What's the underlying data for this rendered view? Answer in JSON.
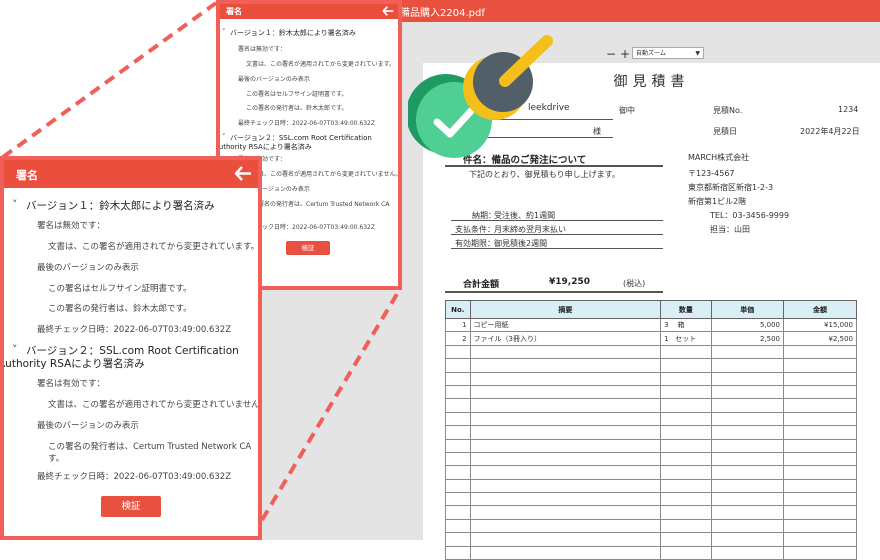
{
  "viewer": {
    "file_name": "備品購入2204.pdf",
    "zoom_minus": "−",
    "zoom_plus": "+",
    "zoom_value": "自動ズーム"
  },
  "document": {
    "title": "御見積書",
    "to_company": "leekdrive",
    "honorific_company": "御中",
    "honorific_person": "様",
    "estimate_no_label": "見積No.",
    "estimate_no": "1234",
    "estimate_date_label": "見積日",
    "estimate_date": "2022年4月22日",
    "subject": "件名：備品のご発注について",
    "intro": "下記のとおり、御見積もり申し上げます。",
    "issuer": {
      "company": "MARCH株式会社",
      "postal": "〒123-4567",
      "address1": "東京都新宿区新宿1-2-3",
      "address2": "新宿第1ビル2階",
      "tel": "TEL：03-3456-9999",
      "person": "担当：山田"
    },
    "terms": [
      {
        "label": "納期：",
        "value": "受注後、約1週間"
      },
      {
        "label": "支払条件：",
        "value": "月末締め翌月末払い"
      },
      {
        "label": "有効期限：",
        "value": "御見積後2週間"
      }
    ],
    "total_label": "合計金額",
    "total_value": "¥19,250",
    "tax_note": "(税込)",
    "table": {
      "headers": [
        "No.",
        "摘要",
        "数量",
        "単価",
        "金額"
      ],
      "rows": [
        {
          "no": "1",
          "desc": "コピー用紙",
          "qty": "3",
          "unit": "箱",
          "price": "5,000",
          "amount": "¥15,000"
        },
        {
          "no": "2",
          "desc": "ファイル（3冊入り）",
          "qty": "1",
          "unit": "セット",
          "price": "2,500",
          "amount": "¥2,500"
        }
      ]
    }
  },
  "signature_panel": {
    "title": "署名",
    "versions": [
      {
        "heading": "バージョン１：鈴木太郎により署名済み",
        "status": "署名は無効です：",
        "detail": "文書は、この署名が適用されてから変更されています。",
        "last_version": "最後のバージョンのみ表示",
        "cert": "この署名はセルフサイン証明書です。",
        "issuer": "この署名の発行者は、鈴木太郎です。",
        "checked": "最終チェック日時：2022-06-07T03:49:00.632Z"
      },
      {
        "heading_line1": "バージョン２：SSL.com Root Certification",
        "heading_line2": "Authority RSAにより署名済み",
        "status": "署名は有効です：",
        "detail": "文書は、この署名が適用されてから変更されていません。",
        "last_version": "最後のバージョンのみ表示",
        "issuer_line1": "この署名の発行者は、Certum Trusted Network CA",
        "issuer_line2": "す。",
        "checked": "最終チェック日時：2022-06-07T03:49:00.632Z"
      }
    ],
    "verify_button": "検証"
  },
  "colors": {
    "accent": "#ea4f3e",
    "panel_border": "#f25e58",
    "table_header": "#d9eef5",
    "stamp_green": "#2fb37a",
    "stamp_dark": "#525f68",
    "stamp_yellow": "#f5bf1b"
  }
}
